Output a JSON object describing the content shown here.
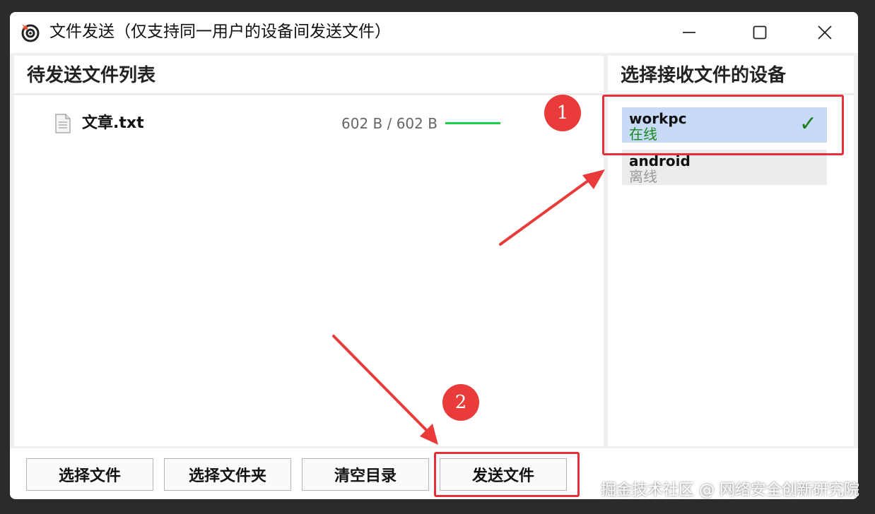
{
  "window": {
    "title": "文件发送（仅支持同一用户的设备间发送文件）",
    "app_icon": "target-logo-icon",
    "controls": [
      "minimize-icon",
      "maximize-icon",
      "close-icon"
    ]
  },
  "left_panel": {
    "title": "待发送文件列表",
    "files": [
      {
        "icon": "text-file-icon",
        "name": "文章.txt",
        "size": "602 B / 602 B",
        "progress": 1.0
      }
    ]
  },
  "right_panel": {
    "title": "选择接收文件的设备",
    "devices": [
      {
        "name": "workpc",
        "status": "在线",
        "selected": true,
        "status_color": "#1a8a1a"
      },
      {
        "name": "android",
        "status": "离线",
        "selected": false,
        "status_color": "#9a9a9a"
      }
    ]
  },
  "toolbar": {
    "select_file": "选择文件",
    "select_folder": "选择文件夹",
    "clear_list": "清空目录",
    "send_file": "发送文件"
  },
  "annotations": {
    "badge_1": "1",
    "badge_2": "2",
    "accent_color": "#e5303a"
  },
  "watermark": "掘金技术社区 @ 网络安全创新研究院"
}
